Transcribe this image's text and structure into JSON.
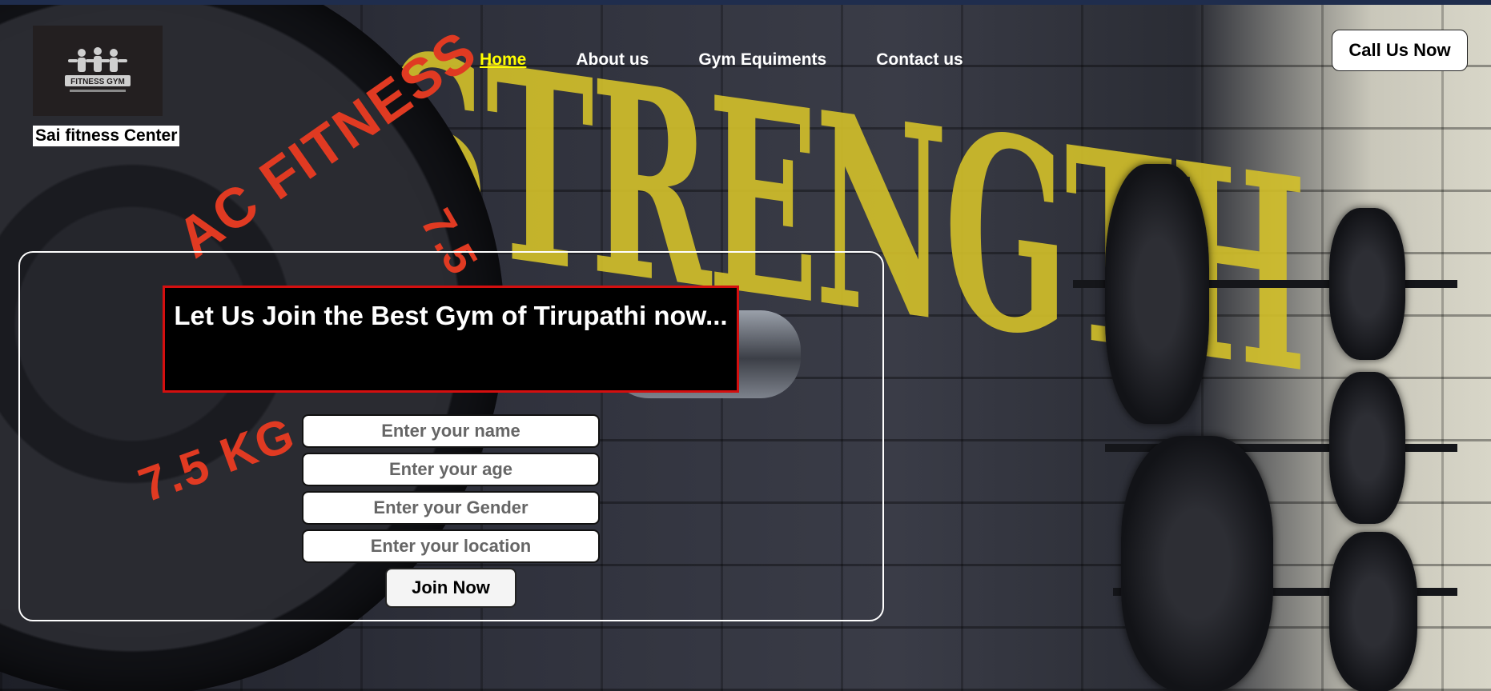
{
  "brand": {
    "name": "Sai fitness Center",
    "logo_text": "FITNESS GYM"
  },
  "nav": {
    "items": [
      {
        "label": "Home",
        "active": true
      },
      {
        "label": "About us",
        "active": false
      },
      {
        "label": "Gym Equiments",
        "active": false
      },
      {
        "label": "Contact us",
        "active": false
      }
    ]
  },
  "header": {
    "call_label": "Call Us Now"
  },
  "hero": {
    "headline": "Let Us Join the Best Gym of Tirupathi now...",
    "wall_text": "STRENGTH"
  },
  "form": {
    "name_placeholder": "Enter your name",
    "age_placeholder": "Enter your age",
    "gender_placeholder": "Enter your Gender",
    "location_placeholder": "Enter your location",
    "submit_label": "Join Now"
  },
  "colors": {
    "nav_active": "#ffff00",
    "headline_border": "#d40f0f",
    "top_bar": "#1f2d4d"
  }
}
